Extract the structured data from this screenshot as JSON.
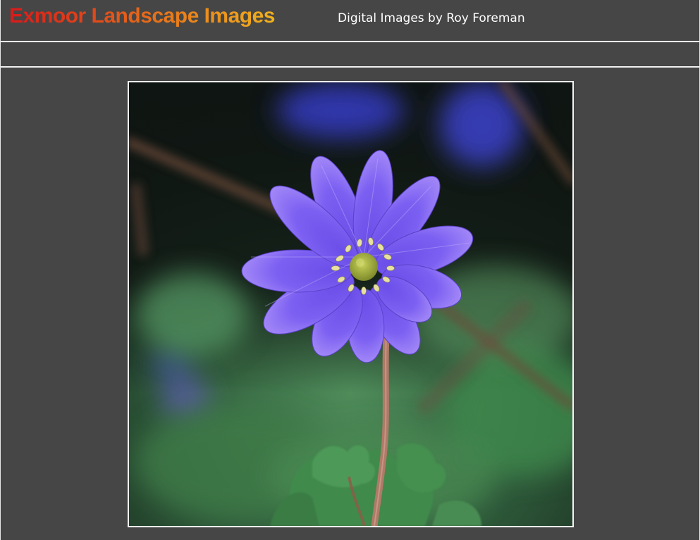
{
  "header": {
    "site_title": "Exmoor Landscape Images",
    "subtitle": "Digital Images by Roy Foreman"
  },
  "photo": {
    "subject": "purple-anemone-flower",
    "colors": {
      "petal": "#7b5cf0",
      "petal_highlight": "#a98cf8",
      "center": "#a8b83a",
      "stamen": "#e8e0a0",
      "stem": "#b07a68",
      "foliage": "#3f8a50",
      "background_dark": "#141414"
    }
  },
  "theme": {
    "background": "#464646",
    "rule": "#f0f0f0"
  }
}
